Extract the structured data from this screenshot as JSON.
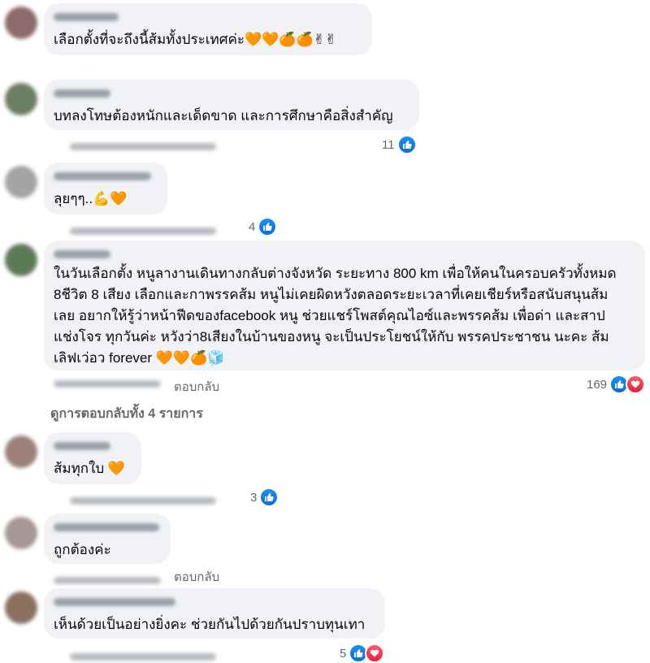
{
  "comments": [
    {
      "text": "เลือกตั้งที่จะถึงนี้ส้มทั้งประเทศค่ะ🧡🧡🍊🍊✌✌",
      "reaction_count": ""
    },
    {
      "text": "บทลงโทษต้องหนักและเด็ดขาด และการศึกษาคือสิ่งสำคัญ",
      "reaction_count": "11"
    },
    {
      "text": "ลุยๆๆ..💪🧡",
      "reaction_count": "4"
    },
    {
      "text": "ในวันเลือกตั้ง หนูลางานเดินทางกลับต่างจังหวัด ระยะทาง 800 km เพื่อให้คนในครอบครัวทั้งหมด\n8ชีวิต 8 เสียง เลือกและกาพรรคส้ม หนูไม่เคยผิดหวังตลอดระยะเวลาที่เคยเชียร์หรือสนับสนุนส้ม\nเลย อยากให้รู้ว่าหน้าฟีดของfacebook หนู ช่วยแชร์โพสต์คุณไอซ์และพรรคส้ม เพื่อด่า และสาป\nแช่งโจร ทุกวันค่ะ หวังว่า8เสียงในบ้านของหนู จะเป็นประโยชน์ให้กับ พรรคประชาชน นะคะ ส้ม\nเลิฟเว่อว forever 🧡🧡🍊🧊",
      "reply_label": "ตอบกลับ",
      "reaction_count": "169",
      "view_replies": "ดูการตอบกลับทั้ง 4 รายการ"
    },
    {
      "text": "ส้มทุกใบ 🧡",
      "reaction_count": "3"
    },
    {
      "text": "ถูกต้องค่ะ",
      "reply_label": "ตอบกลับ"
    },
    {
      "text": "เห็นด้วยเป็นอย่างยิ่งคะ ช่วยกันไปด้วยกันปราบทุนเทา",
      "reaction_count": "5"
    }
  ],
  "icons": {
    "like": "thumbs-up-icon",
    "love": "heart-icon"
  },
  "colors": {
    "bubble": "#f0f2f5",
    "like_blue": "#1877f2",
    "love_red": "#f33e58",
    "muted_text": "#65676b"
  }
}
